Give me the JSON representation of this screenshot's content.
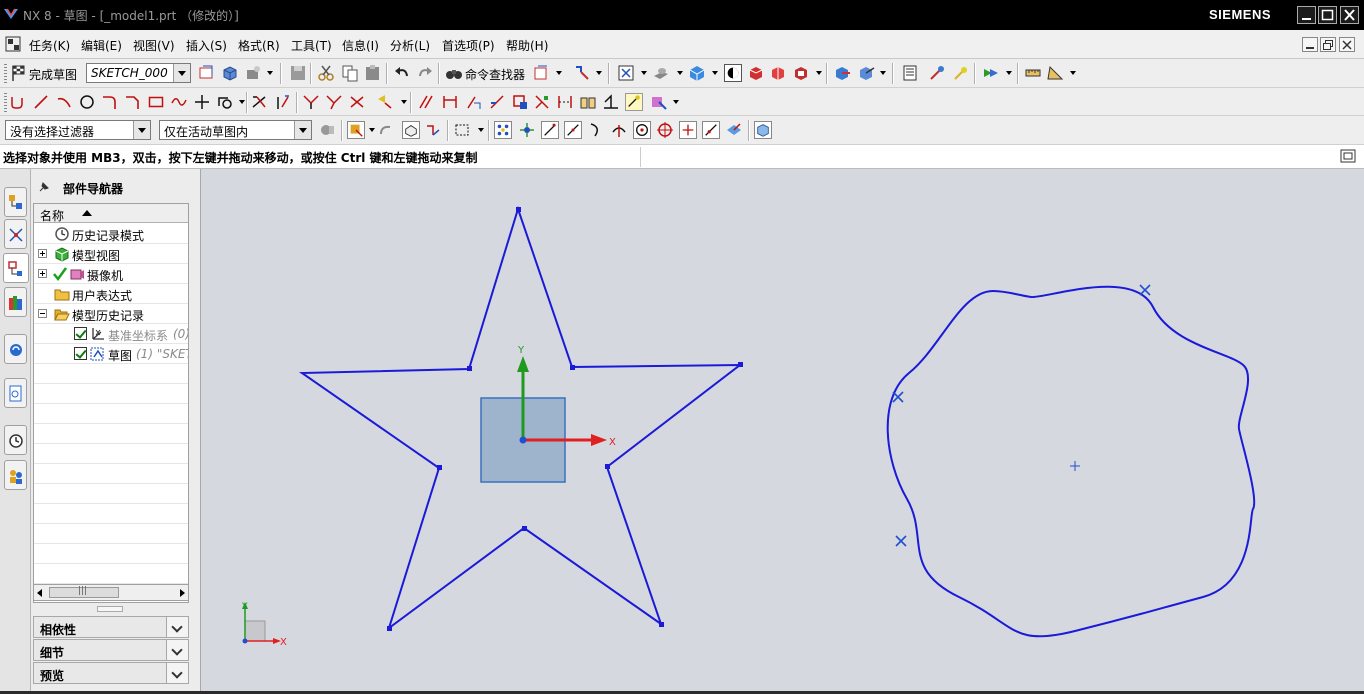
{
  "window": {
    "title": "NX 8 - 草图 - [_model1.prt （修改的）]",
    "brand": "SIEMENS",
    "controls": [
      "minimize",
      "maximize",
      "close"
    ]
  },
  "menubar": {
    "items": [
      "任务(K)",
      "编辑(E)",
      "视图(V)",
      "插入(S)",
      "格式(R)",
      "工具(T)",
      "信息(I)",
      "分析(L)",
      "首选项(P)",
      "帮助(H)"
    ]
  },
  "toolbar1": {
    "finish_sketch_label": "完成草图",
    "sketch_name": "SKETCH_000",
    "command_finder_label": "命令查找器"
  },
  "toolbar3": {
    "selection_filter": "没有选择过滤器",
    "selection_scope": "仅在活动草图内"
  },
  "status": {
    "message": "选择对象并使用 MB3，双击，按下左键并拖动来移动，或按住 Ctrl 键和左键拖动来复制"
  },
  "navigator": {
    "title": "部件导航器",
    "column_header": "名称",
    "rows": [
      {
        "label": "历史记录模式",
        "icon": "clock-icon"
      },
      {
        "label": "模型视图",
        "icon": "model-views-icon"
      },
      {
        "label": "摄像机",
        "icon": "camera-icon"
      },
      {
        "label": "用户表达式",
        "icon": "folder-icon"
      },
      {
        "label": "模型历史记录",
        "icon": "folder-open-icon"
      },
      {
        "label": "基准坐标系",
        "suffix": "(0)",
        "icon": "datum-csys-icon"
      },
      {
        "label": "草图",
        "suffix": "(1) \"SKET",
        "icon": "sketch-icon"
      }
    ],
    "panels": [
      "相依性",
      "细节",
      "预览"
    ]
  },
  "graphics": {
    "sketch_axis_x": "X",
    "sketch_axis_y": "Y",
    "triad_x": "X",
    "triad_y": "Y",
    "curve_color": "#1a1ad8",
    "background": "#d6d8e0"
  },
  "colors": {
    "x_axis": "#e02020",
    "y_axis": "#1f9a1f",
    "plane_fill": "#9eb4cc"
  }
}
